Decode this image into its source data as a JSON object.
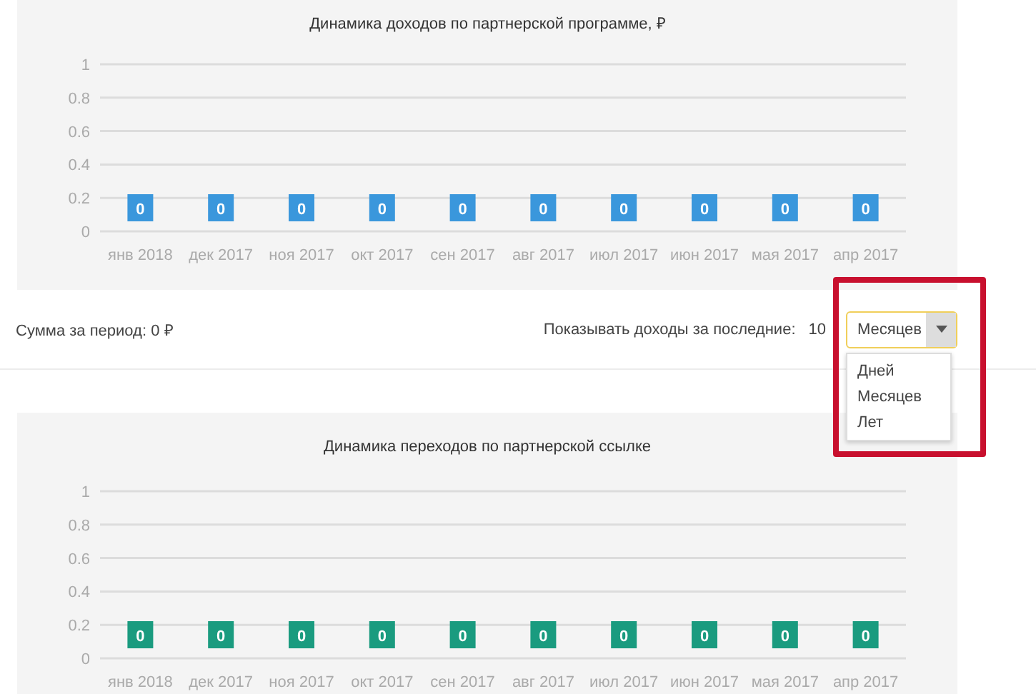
{
  "charts": [
    {
      "chart_data": {
        "type": "bar",
        "grid": true,
        "title": "Динамика доходов по партнерской программе, ₽",
        "categories": [
          "янв 2018",
          "дек 2017",
          "ноя 2017",
          "окт 2017",
          "сен 2017",
          "авг 2017",
          "июл 2017",
          "июн 2017",
          "мая 2017",
          "апр 2017"
        ],
        "ylim": [
          0,
          1
        ],
        "yticks": [
          0,
          0.2,
          0.4,
          0.6,
          0.8,
          1
        ],
        "data_labels": true,
        "series": [
          {
            "color": "#3a97dc",
            "values": [
              0,
              0,
              0,
              0,
              0,
              0,
              0,
              0,
              0,
              0
            ]
          }
        ]
      }
    },
    {
      "chart_data": {
        "type": "bar",
        "grid": true,
        "title": "Динамика переходов по партнерской ссылке",
        "categories": [
          "янв 2018",
          "дек 2017",
          "ноя 2017",
          "окт 2017",
          "сен 2017",
          "авг 2017",
          "июл 2017",
          "июн 2017",
          "мая 2017",
          "апр 2017"
        ],
        "ylim": [
          0,
          1
        ],
        "yticks": [
          0,
          0.2,
          0.4,
          0.6,
          0.8,
          1
        ],
        "data_labels": true,
        "series": [
          {
            "color": "#1a9b7f",
            "values": [
              0,
              0,
              0,
              0,
              0,
              0,
              0,
              0,
              0,
              0
            ]
          }
        ]
      }
    }
  ],
  "summary": "Сумма за период: 0 ₽",
  "period": {
    "label": "Показывать доходы за последние:",
    "count": "10",
    "select": {
      "value": "Месяцев",
      "expanded": true,
      "options": [
        {
          "label": "Дней"
        },
        {
          "label": "Месяцев"
        },
        {
          "label": "Лет"
        }
      ]
    }
  }
}
